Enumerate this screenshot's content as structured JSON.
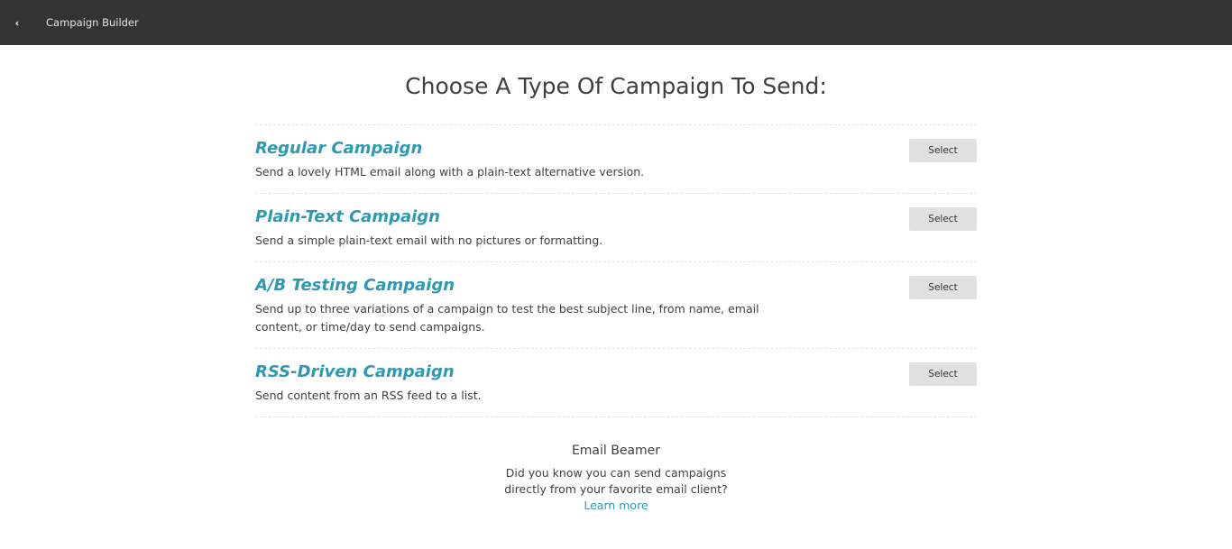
{
  "header": {
    "back_icon": "back-arrow-icon",
    "title": "Campaign Builder"
  },
  "main": {
    "heading": "Choose A Type Of Campaign To Send:",
    "campaigns": [
      {
        "name": "Regular Campaign",
        "description": "Send a lovely HTML email along with a plain-text alternative version.",
        "button_label": "Select"
      },
      {
        "name": "Plain-Text Campaign",
        "description": "Send a simple plain-text email with no pictures or formatting.",
        "button_label": "Select"
      },
      {
        "name": "A/B Testing Campaign",
        "description": "Send up to three variations of a campaign to test the best subject line, from name, email content, or time/day to send campaigns.",
        "button_label": "Select"
      },
      {
        "name": "RSS-Driven Campaign",
        "description": "Send content from an RSS feed to a list.",
        "button_label": "Select"
      }
    ]
  },
  "beamer": {
    "title": "Email Beamer",
    "text": "Did you know you can send campaigns directly from your favorite email client?",
    "link_label": "Learn more"
  },
  "colors": {
    "topbar": "#333333",
    "accent": "#2c9ab7",
    "button_bg": "#e0e0e0"
  }
}
